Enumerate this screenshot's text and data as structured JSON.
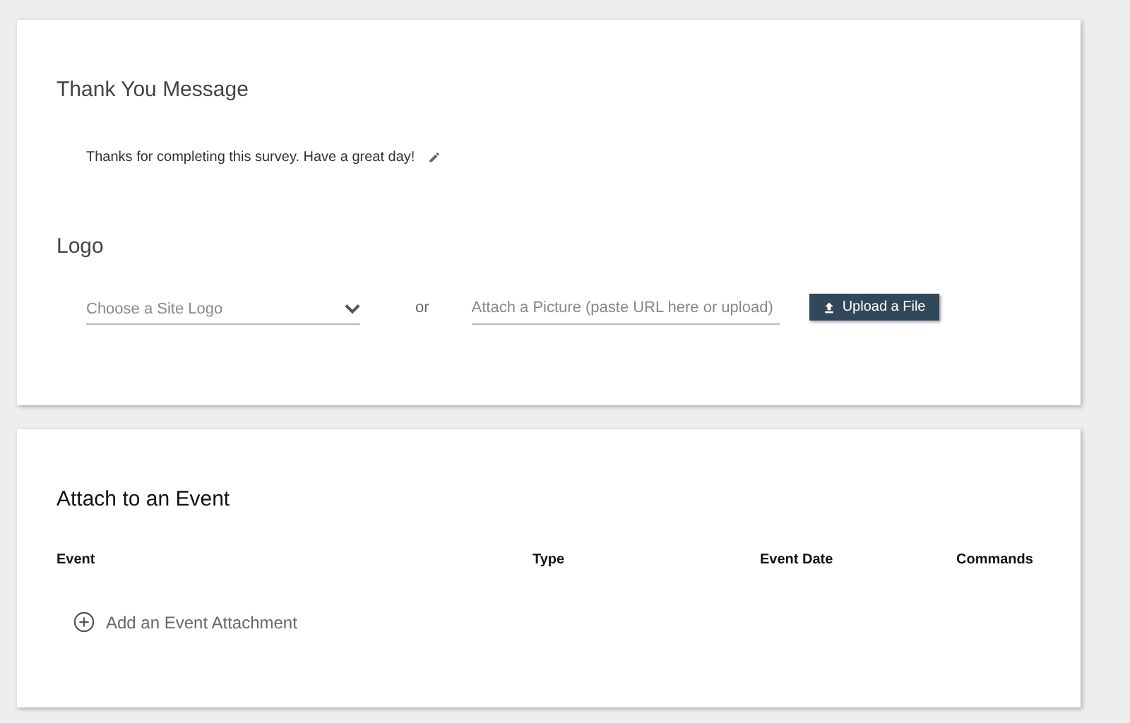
{
  "thank_you": {
    "title": "Thank You Message",
    "message": "Thanks for completing this survey. Have a great day!"
  },
  "logo": {
    "title": "Logo",
    "select": {
      "placeholder": "Choose a Site Logo"
    },
    "separator": "or",
    "picture": {
      "placeholder": "Attach a Picture (paste URL here or upload)"
    },
    "upload_button": "Upload a File"
  },
  "events": {
    "title": "Attach to an Event",
    "columns": [
      "Event",
      "Type",
      "Event Date",
      "Commands"
    ],
    "add_label": "Add an Event Attachment"
  }
}
